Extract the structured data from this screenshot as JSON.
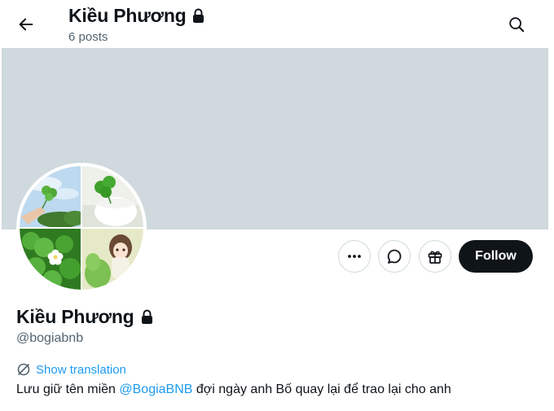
{
  "header": {
    "display_name": "Kiều Phương",
    "post_count": "6 posts",
    "back_icon": "arrow-left-icon",
    "search_icon": "search-icon",
    "lock_icon": "lock-icon"
  },
  "actions": {
    "more_icon": "more-icon",
    "message_icon": "message-icon",
    "gift_icon": "gift-icon",
    "follow_label": "Follow"
  },
  "profile": {
    "display_name": "Kiều Phương",
    "handle": "@bogiabnb",
    "translation_label": "Show translation",
    "bio_before": "Lưu giữ tên miền ",
    "bio_mention": "@BogiaBNB",
    "bio_after": " đợi ngày anh Bố quay lại để trao lại cho anh"
  },
  "colors": {
    "accent": "#1d9bf0",
    "banner": "#cfd9de",
    "text_primary": "#0f1419",
    "text_secondary": "#536471",
    "follow_bg": "#0f1419"
  }
}
